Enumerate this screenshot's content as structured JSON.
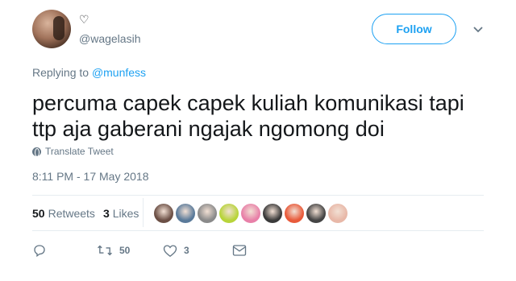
{
  "author": {
    "display_name": "♡",
    "handle": "@wagelasih"
  },
  "header": {
    "follow_label": "Follow"
  },
  "reply": {
    "prefix": "Replying to ",
    "target": "@munfess"
  },
  "tweet": {
    "line1": "percuma capek capek kuliah komunikasi tapi",
    "line2": "ttp aja gaberani ngajak ngomong doi",
    "translate_label": "Translate Tweet",
    "timestamp": "8:11 PM - 17 May 2018"
  },
  "stats": {
    "retweets_count": "50",
    "retweets_label": "Retweets",
    "likes_count": "3",
    "likes_label": "Likes"
  },
  "likers": [
    {
      "color": "#6b4f45"
    },
    {
      "color": "#5a7a9a"
    },
    {
      "color": "#8a8a8a"
    },
    {
      "color": "#b8d43a"
    },
    {
      "color": "#e880a8"
    },
    {
      "color": "#3a3a3a"
    },
    {
      "color": "#e85a3a"
    },
    {
      "color": "#444444"
    },
    {
      "color": "#e8b8a8"
    }
  ],
  "actions": {
    "reply_icon": "reply-icon",
    "retweet_count": "50",
    "like_count": "3"
  },
  "colors": {
    "accent": "#1da1f2",
    "secondary_text": "#657786",
    "primary_text": "#14171a"
  }
}
